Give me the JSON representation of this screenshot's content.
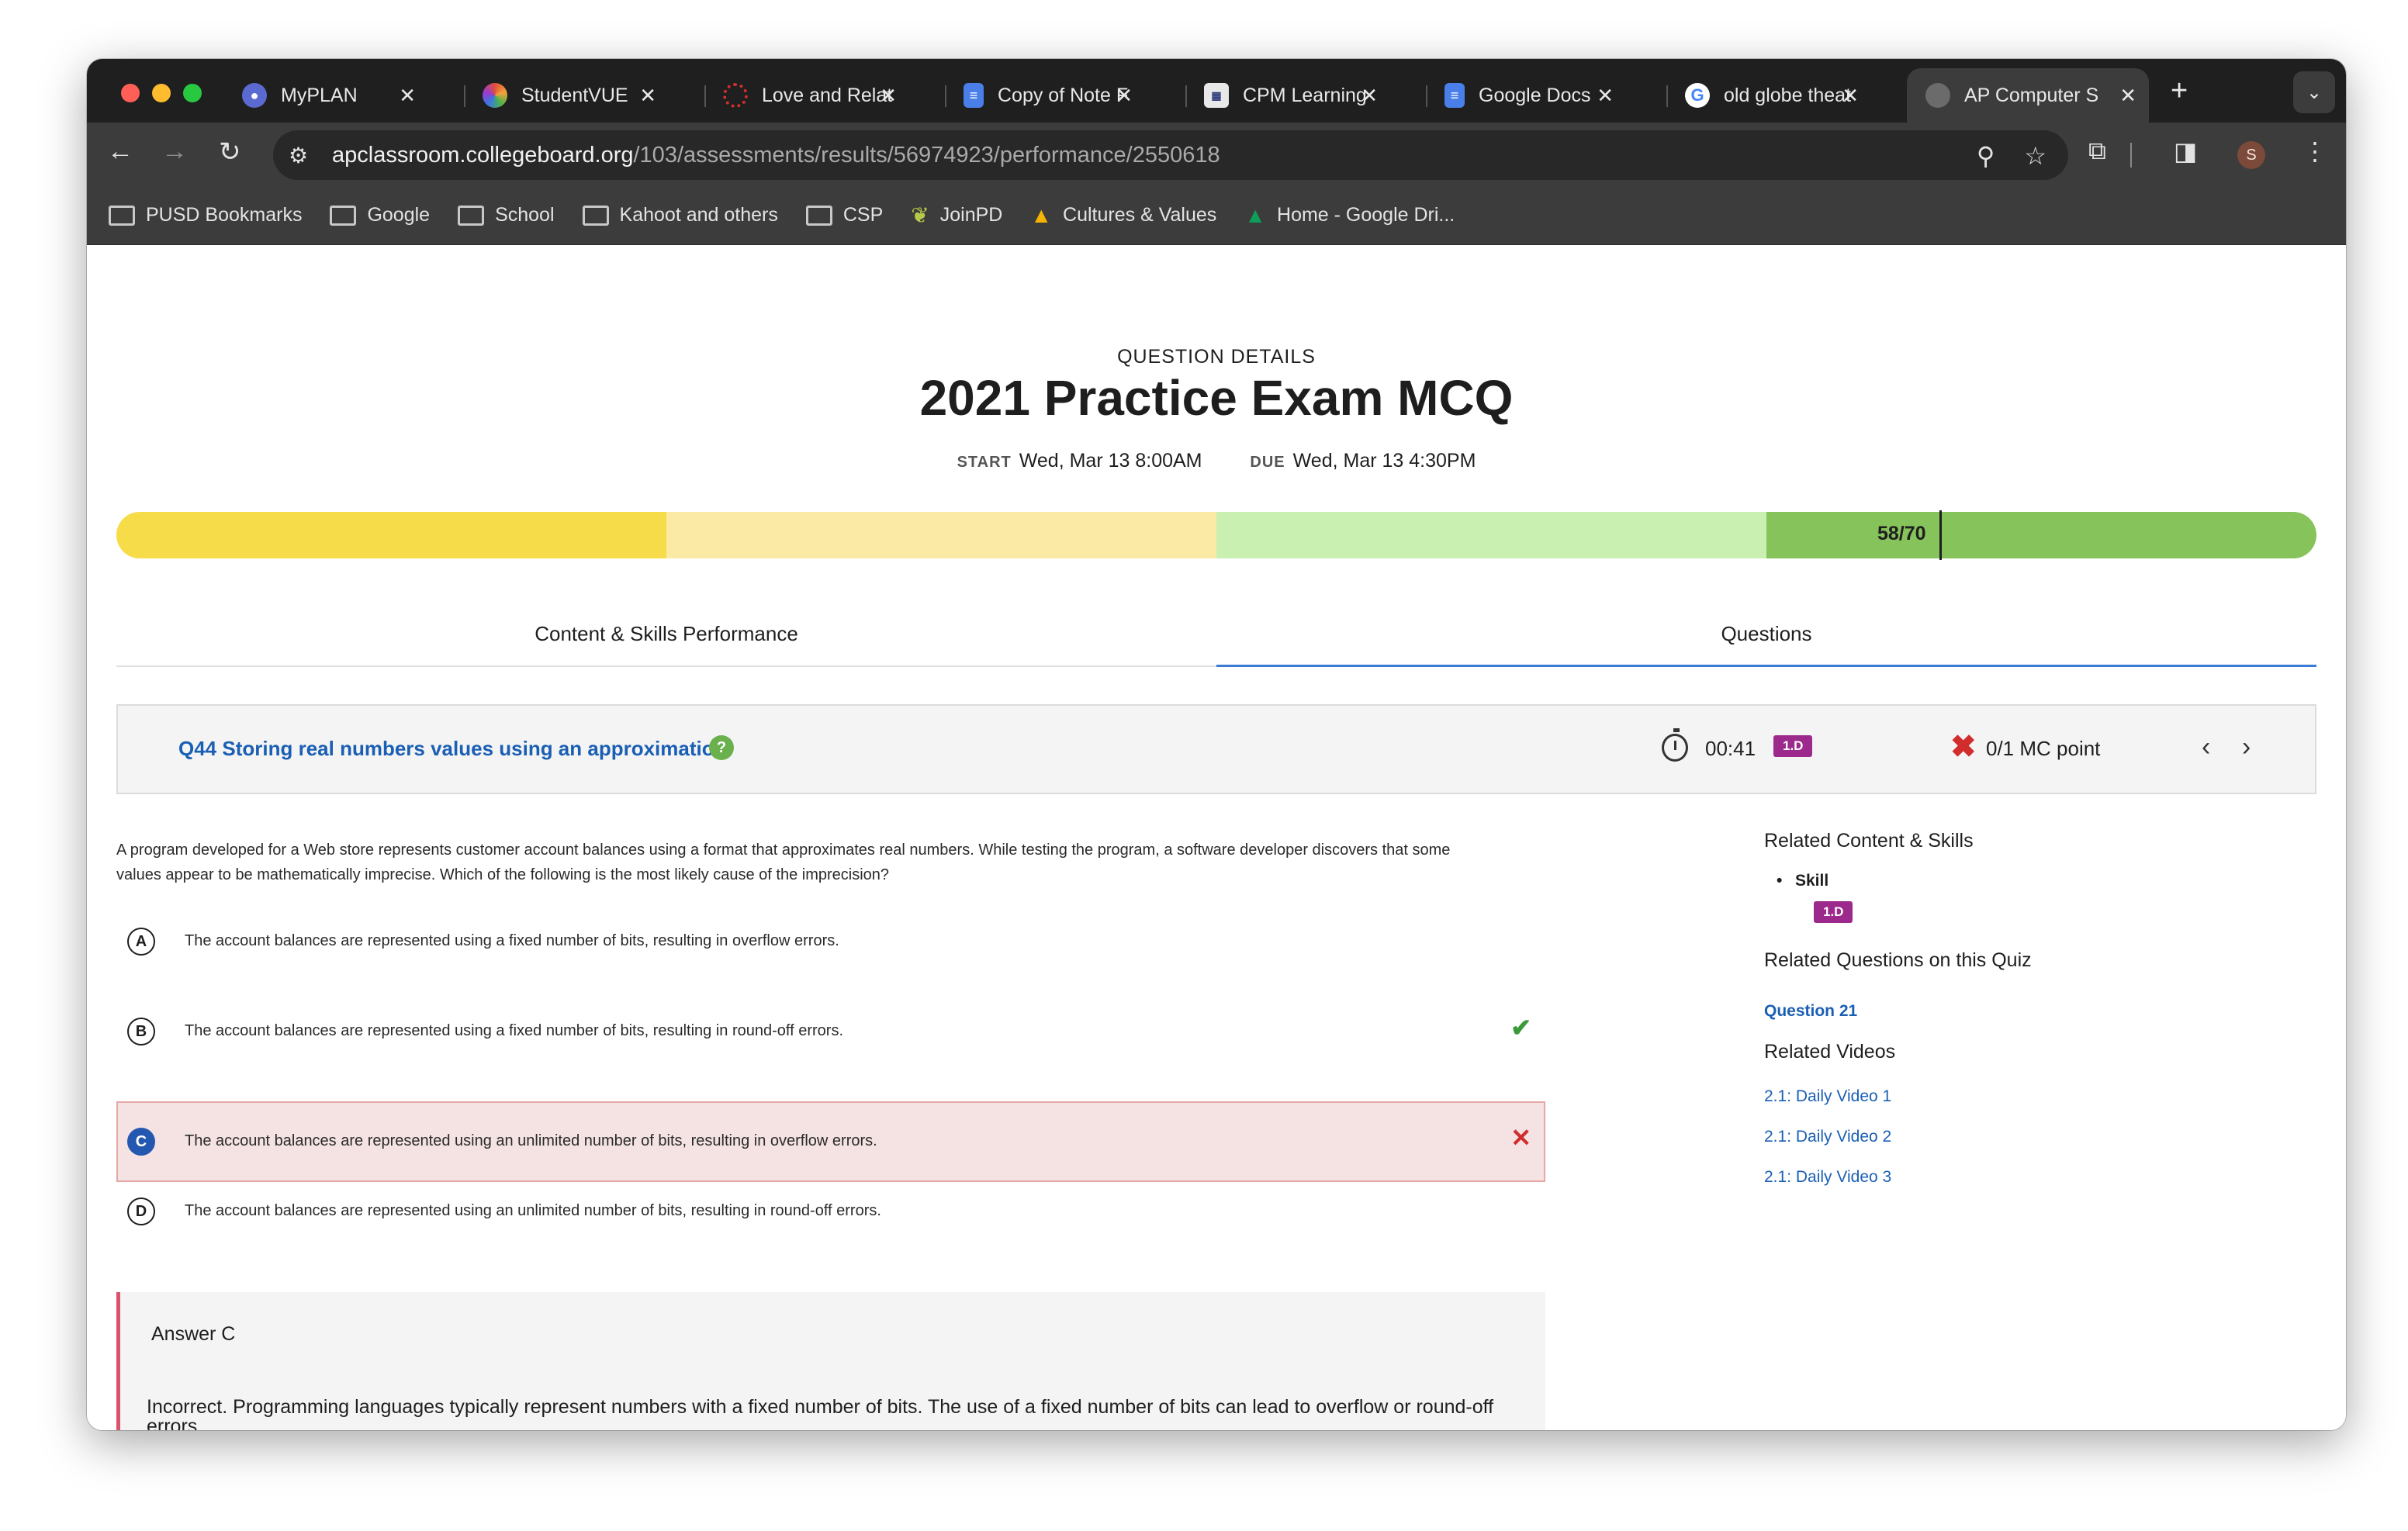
{
  "browser": {
    "tabs": [
      {
        "title": "MyPLAN",
        "icon": "myplan-icon",
        "color": "#5b6ad0"
      },
      {
        "title": "StudentVUE",
        "icon": "studentvue-icon",
        "color": "#e0503a"
      },
      {
        "title": "Love and Relat",
        "icon": "love-relat-icon",
        "color": "#d32f2f"
      },
      {
        "title": "Copy of Note F",
        "icon": "docs-icon",
        "color": "#4a7ee8"
      },
      {
        "title": "CPM Learning",
        "icon": "cpm-icon",
        "color": "#2e3b7a"
      },
      {
        "title": "Google Docs",
        "icon": "docs-icon",
        "color": "#4a7ee8"
      },
      {
        "title": "old globe theat",
        "icon": "google-icon",
        "color": "#ffffff"
      },
      {
        "title": "AP Computer S",
        "icon": "globe-icon",
        "color": "#6b6b6b"
      }
    ],
    "url_host": "apclassroom.collegeboard.org",
    "url_path": "/103/assessments/results/56974923/performance/2550618",
    "avatar_letter": "S",
    "bookmarks": [
      {
        "label": "PUSD Bookmarks",
        "icon": "folder-icon"
      },
      {
        "label": "Google",
        "icon": "folder-icon"
      },
      {
        "label": "School",
        "icon": "folder-icon"
      },
      {
        "label": "Kahoot and others",
        "icon": "folder-icon"
      },
      {
        "label": "CSP",
        "icon": "folder-icon"
      },
      {
        "label": "JoinPD",
        "icon": "pear-icon"
      },
      {
        "label": "Cultures & Values",
        "icon": "drive-icon"
      },
      {
        "label": "Home - Google Dri...",
        "icon": "drive-icon"
      }
    ]
  },
  "header": {
    "section_label": "QUESTION DETAILS",
    "title": "2021 Practice Exam MCQ",
    "start_label": "START",
    "start_value": "Wed, Mar 13 8:00AM",
    "due_label": "DUE",
    "due_value": "Wed, Mar 13 4:30PM"
  },
  "score": {
    "text": "58/70",
    "fraction": 0.8286,
    "band_colors": [
      "#f7dc4a",
      "#faeaa5",
      "#c9f0b0",
      "#86c35a"
    ]
  },
  "tabs": {
    "performance": "Content & Skills Performance",
    "questions": "Questions"
  },
  "question": {
    "link": "Q44 Storing real numbers values using an approximation",
    "help_icon": "?",
    "time": "00:41",
    "skill": "1.D",
    "result_icon": "x-mark-icon",
    "points": "0/1 MC point",
    "stem": "A program developed for a Web store represents customer account balances using a format that approximates real numbers. While testing the program, a software developer discovers that some values appear to be mathematically imprecise. Which of the following is the most likely cause of the imprecision?",
    "choices": [
      {
        "letter": "A",
        "text": "The account balances are represented using a fixed number of bits, resulting in overflow errors.",
        "mark": ""
      },
      {
        "letter": "B",
        "text": "The account balances are represented using a fixed number of bits, resulting in round-off errors.",
        "mark": "✔"
      },
      {
        "letter": "C",
        "text": "The account balances are represented using an unlimited number of bits, resulting in overflow errors.",
        "mark": "✕"
      },
      {
        "letter": "D",
        "text": "The account balances are represented using an unlimited number of bits, resulting in round-off errors.",
        "mark": ""
      }
    ],
    "answer_title": "Answer C",
    "answer_text": "Incorrect. Programming languages typically represent numbers with a fixed number of bits. The use of a fixed number of bits can lead to overflow or round-off errors."
  },
  "sidebar": {
    "related_content_title": "Related Content & Skills",
    "skill_label": "Skill",
    "skill_badge": "1.D",
    "related_questions_title": "Related Questions on this Quiz",
    "related_question": "Question 21",
    "related_videos_title": "Related Videos",
    "videos": [
      "2.1: Daily Video 1",
      "2.1: Daily Video 2",
      "2.1: Daily Video 3"
    ]
  }
}
